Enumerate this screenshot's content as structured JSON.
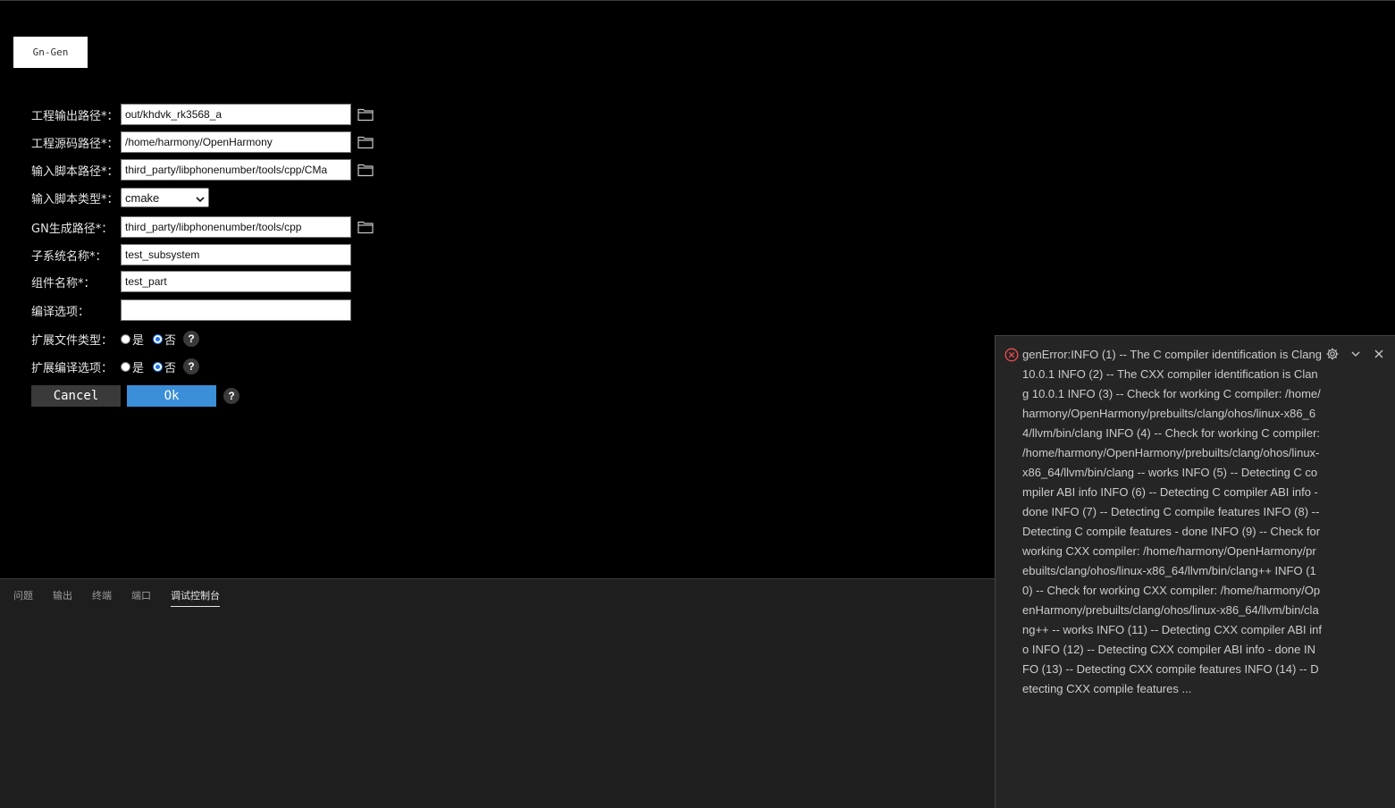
{
  "tab": {
    "label": "Gn-Gen"
  },
  "form": {
    "output_path": {
      "label": "工程输出路径*：",
      "value": "out/khdvk_rk3568_a"
    },
    "source_path": {
      "label": "工程源码路径*：",
      "value": "/home/harmony/OpenHarmony"
    },
    "script_path": {
      "label": "输入脚本路径*：",
      "value": "third_party/libphonenumber/tools/cpp/CMa"
    },
    "script_type": {
      "label": "输入脚本类型*：",
      "value": "cmake"
    },
    "gn_path": {
      "label": "GN生成路径*：",
      "value": "third_party/libphonenumber/tools/cpp"
    },
    "subsystem": {
      "label": "子系统名称*：",
      "value": "test_subsystem"
    },
    "component": {
      "label": "组件名称*：",
      "value": "test_part"
    },
    "compile_opts": {
      "label": "编译选项：",
      "value": ""
    },
    "ext_file_type": {
      "label": "扩展文件类型：",
      "yes": "是",
      "no": "否",
      "selected": "no"
    },
    "ext_compile_opts": {
      "label": "扩展编译选项：",
      "yes": "是",
      "no": "否",
      "selected": "no"
    },
    "help_glyph": "?",
    "cancel_label": "Cancel",
    "ok_label": "Ok"
  },
  "panel": {
    "tabs": [
      "问题",
      "输出",
      "终端",
      "端口",
      "调试控制台"
    ],
    "active_tab": 4
  },
  "notification": {
    "message": "genError:INFO (1) -- The C compiler identification is Clang 10.0.1 INFO (2) -- The CXX compiler identification is Clang 10.0.1 INFO (3) -- Check for working C compiler: /home/harmony/OpenHarmony/prebuilts/clang/ohos/linux-x86_64/llvm/bin/clang INFO (4) -- Check for working C compiler: /home/harmony/OpenHarmony/prebuilts/clang/ohos/linux-x86_64/llvm/bin/clang -- works INFO (5) -- Detecting C compiler ABI info INFO (6) -- Detecting C compiler ABI info - done INFO (7) -- Detecting C compile features INFO (8) -- Detecting C compile features - done INFO (9) -- Check for working CXX compiler: /home/harmony/OpenHarmony/prebuilts/clang/ohos/linux-x86_64/llvm/bin/clang++ INFO (10) -- Check for working CXX compiler: /home/harmony/OpenHarmony/prebuilts/clang/ohos/linux-x86_64/llvm/bin/clang++ -- works INFO (11) -- Detecting CXX compiler ABI info INFO (12) -- Detecting CXX compiler ABI info - done INFO (13) -- Detecting CXX compile features INFO (14) -- Detecting CXX compile features ...",
    "error_color": "#f14c4c"
  }
}
